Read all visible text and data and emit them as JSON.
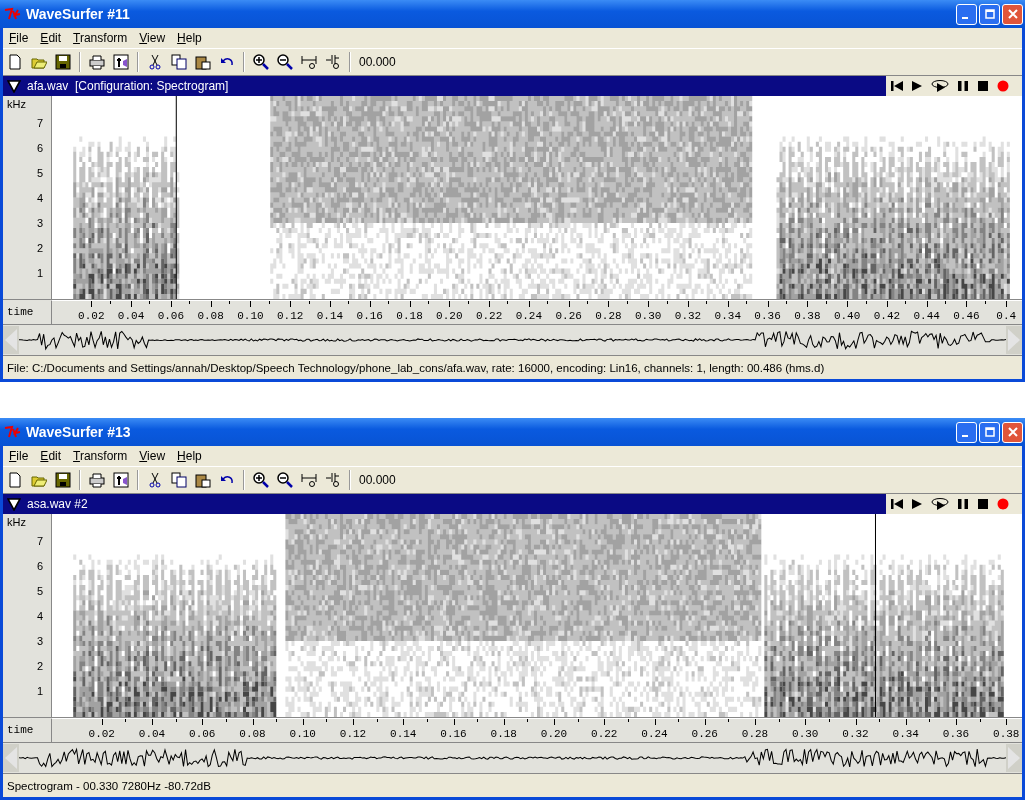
{
  "windows": [
    {
      "title": "WaveSurfer #11",
      "menu": [
        "File",
        "Edit",
        "Transform",
        "View",
        "Help"
      ],
      "time_display": "00.000",
      "pane_title": "afa.wav  [Configuration: Spectrogram]",
      "freq_unit": "kHz",
      "freq_labels": [
        "7",
        "6",
        "5",
        "4",
        "3",
        "2",
        "1"
      ],
      "time_label": "time",
      "time_ticks": [
        "0.02",
        "0.04",
        "0.06",
        "0.08",
        "0.10",
        "0.12",
        "0.14",
        "0.16",
        "0.18",
        "0.20",
        "0.22",
        "0.24",
        "0.26",
        "0.28",
        "0.30",
        "0.32",
        "0.34",
        "0.36",
        "0.38",
        "0.40",
        "0.42",
        "0.44",
        "0.46",
        "0.4"
      ],
      "status": "File: C:/Documents and Settings/annah/Desktop/Speech Technology/phone_lab_cons/afa.wav, rate: 16000, encoding: Lin16, channels: 1, length: 00.486 (hms.d)"
    },
    {
      "title": "WaveSurfer #13",
      "menu": [
        "File",
        "Edit",
        "Transform",
        "View",
        "Help"
      ],
      "time_display": "00.000",
      "pane_title": "asa.wav #2",
      "freq_unit": "kHz",
      "freq_labels": [
        "7",
        "6",
        "5",
        "4",
        "3",
        "2",
        "1"
      ],
      "time_label": "time",
      "time_ticks": [
        "0.02",
        "0.04",
        "0.06",
        "0.08",
        "0.10",
        "0.12",
        "0.14",
        "0.16",
        "0.18",
        "0.20",
        "0.22",
        "0.24",
        "0.26",
        "0.28",
        "0.30",
        "0.32",
        "0.34",
        "0.36",
        "0.38"
      ],
      "status": "Spectrogram - 00.330 7280Hz -80.72dB"
    }
  ]
}
